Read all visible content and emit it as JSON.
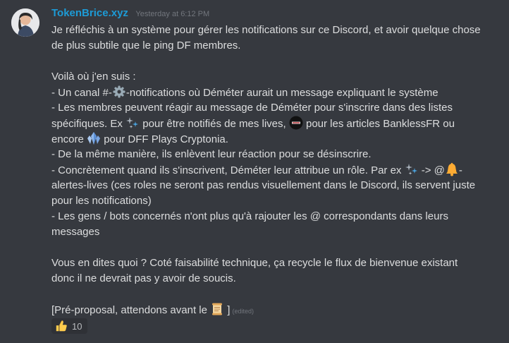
{
  "message": {
    "username": "TokenBrice.xyz",
    "timestamp": "Yesterday at 6:12 PM",
    "lines": {
      "l1": "Je réfléchis à un système pour gérer les notifications sur ce Discord, et avoir quelque chose",
      "l2": "de plus subtile que le ping DF membres.",
      "l3": "Voilà où j'en suis :",
      "l4a": "- Un canal #-",
      "l4b": "-notifications où Déméter aurait un message expliquant le système",
      "l5": "- Les membres peuvent réagir au message de Déméter pour s'inscrire dans des listes",
      "l6a": "spécifiques. Ex ",
      "l6b": " pour être notifiés de mes lives, ",
      "l6c": " pour les articles BanklessFR ou",
      "l7a": "encore ",
      "l7b": " pour DFF Plays Cryptonia.",
      "l8": "- De la même manière, ils enlèvent leur réaction pour se désinscrire.",
      "l9a": "- Concrètement quand ils s'inscrivent, Déméter leur attribue un rôle. Par ex ",
      "l9b": " -> @",
      "l9c": "-",
      "l10": "alertes-lives (ces roles ne seront pas rendus visuellement dans le Discord, ils servent juste",
      "l11": "pour les notifications)",
      "l12": "- Les gens / bots concernés n'ont plus qu'à rajouter les @ correspondants dans leurs",
      "l13": "messages",
      "l14": "Vous en dites quoi ? Coté faisabilité technique, ça recycle le flux de bienvenue existant",
      "l15": "donc il ne devrait pas y avoir de soucis.",
      "l16a": "[Pré-proposal, attendons avant le ",
      "l16b": " ]"
    },
    "edited": "(edited)",
    "reaction": {
      "emoji": "thumbs-up",
      "count": "10"
    }
  },
  "colors": {
    "background": "#36393f",
    "username": "#1d9bd6",
    "text": "#dcddde",
    "muted": "#72767d",
    "reaction_bg": "#2f3136"
  },
  "icons": [
    "gear-icon",
    "sparkles-icon",
    "bankless-logo-icon",
    "crystal-icon",
    "bell-icon",
    "scroll-icon",
    "thumbs-up-icon"
  ]
}
